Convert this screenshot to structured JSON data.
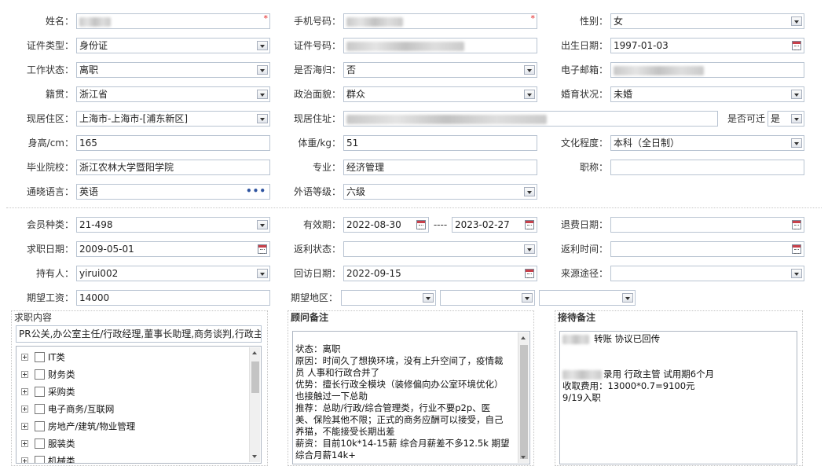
{
  "personal": {
    "name_label": "姓名：",
    "phone_label": "手机号码：",
    "gender_label": "性别：",
    "gender_value": "女",
    "id_type_label": "证件类型：",
    "id_type_value": "身份证",
    "id_no_label": "证件号码：",
    "birth_label": "出生日期：",
    "birth_value": "1997-01-03",
    "work_status_label": "工作状态：",
    "work_status_value": "离职",
    "overseas_label": "是否海归：",
    "overseas_value": "否",
    "email_label": "电子邮箱：",
    "native_label": "籍贯：",
    "native_value": "浙江省",
    "political_label": "政治面貌：",
    "political_value": "群众",
    "marital_label": "婚育状况：",
    "marital_value": "未婚",
    "residence_label": "现居住区：",
    "residence_value": "上海市-上海市-[浦东新区]",
    "address_label": "现居住址：",
    "relocate_label": "是否可迁",
    "relocate_value": "是",
    "height_label": "身高/cm：",
    "height_value": "165",
    "weight_label": "体重/kg：",
    "weight_value": "51",
    "education_label": "文化程度：",
    "education_value": "本科（全日制）",
    "school_label": "毕业院校：",
    "school_value": "浙江农林大学暨阳学院",
    "major_label": "专业：",
    "major_value": "经济管理",
    "title_label": "职称：",
    "language_label": "通晓语言：",
    "language_value": "英语",
    "language_more": "•••",
    "lang_level_label": "外语等级：",
    "lang_level_value": "六级",
    "required_mark": "*"
  },
  "membership": {
    "member_type_label": "会员种类：",
    "member_type_value": "21-498",
    "valid_label": "有效期：",
    "valid_from": "2022-08-30",
    "valid_sep": "----",
    "valid_to": "2023-02-27",
    "refund_date_label": "退费日期：",
    "apply_date_label": "求职日期：",
    "apply_date_value": "2009-05-01",
    "rebate_status_label": "返利状态：",
    "rebate_time_label": "返利时间：",
    "holder_label": "持有人：",
    "holder_value": "yirui002",
    "visit_date_label": "回访日期：",
    "visit_date_value": "2022-09-15",
    "source_label": "来源途径：",
    "salary_label": "期望工资：",
    "salary_value": "14000",
    "region_label": "期望地区："
  },
  "job_content": {
    "title": "求职内容",
    "summary": "PR公关,办公室主任/行政经理,董事长助理,商务谈判,行政主",
    "categories": [
      {
        "label": "IT类"
      },
      {
        "label": "财务类"
      },
      {
        "label": "采购类"
      },
      {
        "label": "电子商务/互联网"
      },
      {
        "label": "房地产/建筑/物业管理"
      },
      {
        "label": "服装类"
      },
      {
        "label": "机械类"
      }
    ]
  },
  "consultant_notes": {
    "title": "顾问备注",
    "lines": [
      "状态：离职",
      "原因：时间久了想换环境，没有上升空间了，疫情裁",
      "员  人事和行政合并了",
      "优势：擅长行政全模块（装修偏向办公室环境优化）",
      "也接触过一下总助",
      "推荐：总助/行政/综合管理类，行业不要p2p、医",
      "美、保险其他不限；正式的商务应酬可以接受，自己",
      "养猫，不能接受长期出差",
      "薪资：目前10k*14-15薪  综合月薪差不多12.5k  期望",
      "综合月薪14k+"
    ]
  },
  "reception_notes": {
    "title": "接待备注",
    "line1": "转账    协议已回传",
    "line2": "录用   行政主管   试用期6个月",
    "line3": "收取费用：13000*0.7=9100元",
    "line4": "9/19入职"
  }
}
